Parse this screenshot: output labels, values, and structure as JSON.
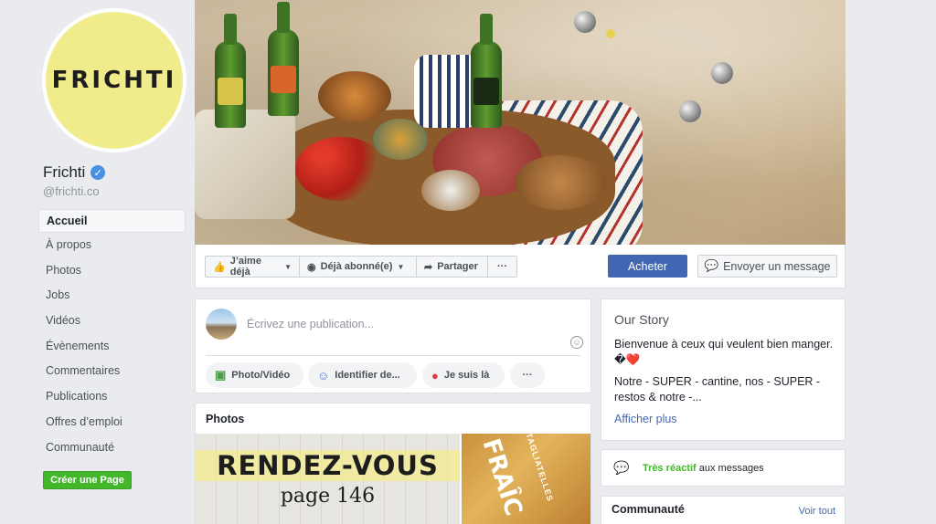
{
  "page": {
    "logo_text": "FRICHTI",
    "name": "Frichti",
    "handle": "@frichti.co",
    "verified_icon": "check-icon"
  },
  "nav": [
    {
      "label": "Accueil",
      "active": true
    },
    {
      "label": "À propos"
    },
    {
      "label": "Photos"
    },
    {
      "label": "Jobs"
    },
    {
      "label": "Vidéos"
    },
    {
      "label": "Évènements"
    },
    {
      "label": "Commentaires"
    },
    {
      "label": "Publications"
    },
    {
      "label": "Offres d’emploi"
    },
    {
      "label": "Communauté"
    }
  ],
  "create_page": "Créer une Page",
  "actions": {
    "like": "J’aime déjà",
    "follow": "Déjà abonné(e)",
    "share": "Partager",
    "more": "···",
    "buy": "Acheter",
    "message": "Envoyer un message"
  },
  "composer": {
    "placeholder": "Écrivez une publication...",
    "photo_video": "Photo/Vidéo",
    "tag": "Identifier de...",
    "feeling": "Je suis là",
    "more": "···"
  },
  "photos": {
    "title": "Photos",
    "photo1_line1": "RENDEZ-VOUS",
    "photo1_line2": "page 146",
    "photo2_title": "FRAÎC",
    "photo2_sub": "TAGLIATELLES"
  },
  "story": {
    "title": "Our Story",
    "line1": "Bienvenue à ceux qui veulent bien manger. �❤️",
    "line2": "Notre - SUPER - cantine, nos - SUPER - restos & notre -...",
    "more": "Afficher plus"
  },
  "responsive": {
    "highlight": "Très réactif",
    "rest": " aux messages"
  },
  "community": {
    "title": "Communauté",
    "link": "Voir tout"
  },
  "colors": {
    "facebook_blue": "#4267b2",
    "green": "#42b72a",
    "logo_yellow": "#f1ec8b"
  }
}
